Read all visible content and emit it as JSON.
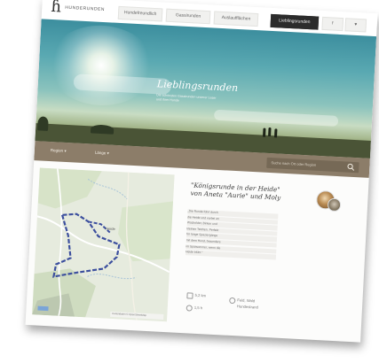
{
  "site": {
    "logo_text": "HUNDERUNDEN"
  },
  "nav": {
    "items": [
      {
        "label": "Hundefreundlich"
      },
      {
        "label": "Gassirunden"
      },
      {
        "label": "Auslaufflächen"
      },
      {
        "label": "Lieblingsrunden"
      },
      {
        "label": "f"
      },
      {
        "label": "♥"
      }
    ],
    "active_index": 3
  },
  "hero": {
    "title": "Lieblingsrunden",
    "subtitle_line1": "Die schönsten Gassirunden unserer Leser",
    "subtitle_line2": "und ihrer Hunde"
  },
  "filters": {
    "region_label": "Region",
    "length_label": "Länge",
    "search_placeholder": "Suche nach Ort oder Region"
  },
  "route": {
    "title_line1": "\"Königsrunde in der Heide\"",
    "title_line2": "von Aneta \"Aurie\" und Moly",
    "description_lines": [
      "„Die Runde führt durch",
      "die Heide und vorbei an",
      "Wacholder, Birken und",
      "kleinen Teichen. Perfekt",
      "für lange Spaziergänge",
      "mit dem Hund, besonders",
      "im Spätsommer, wenn die",
      "Heide blüht.“"
    ],
    "stats": {
      "distance": "5,2 km",
      "duration": "1,5 h",
      "terrain_line1": "Feld, Wald",
      "terrain_line2": "Hundestrand"
    }
  },
  "map": {
    "label": "Heide",
    "attribution": "Kartendaten © OpenStreetMap"
  },
  "colors": {
    "filterbar": "#8c7d69",
    "route_line": "#3c4f9e",
    "nav_active": "#2c2c2c"
  }
}
